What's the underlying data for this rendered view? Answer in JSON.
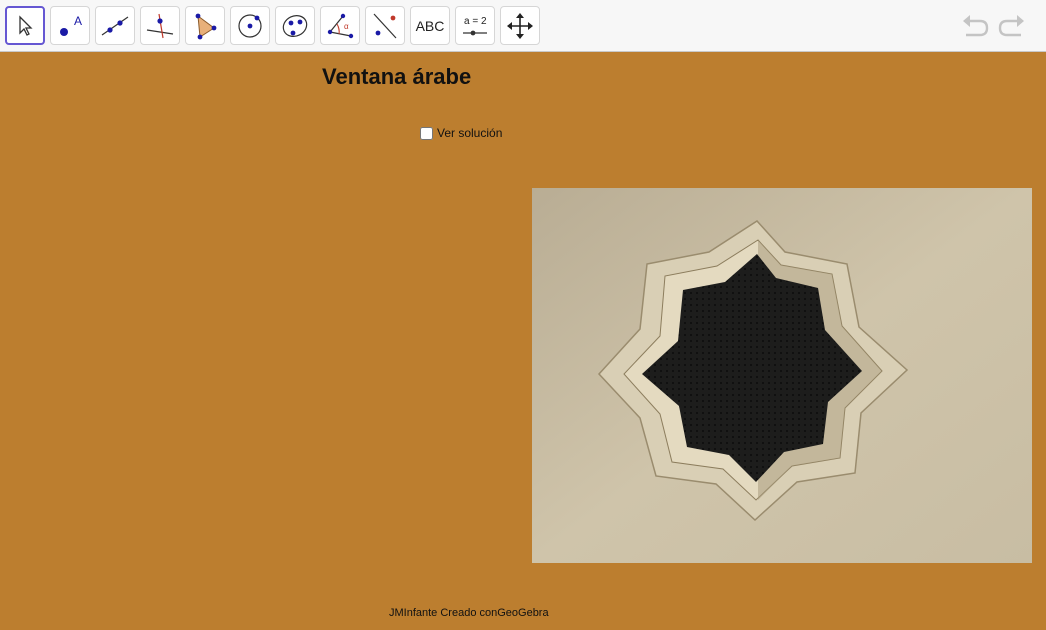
{
  "toolbar": {
    "tools": [
      {
        "id": "move",
        "icon": "pointer-arrow-icon",
        "selected": true
      },
      {
        "id": "point",
        "icon": "point-icon",
        "label": "A"
      },
      {
        "id": "line",
        "icon": "line-through-points-icon"
      },
      {
        "id": "perpendicular",
        "icon": "perpendicular-line-icon"
      },
      {
        "id": "polygon",
        "icon": "polygon-icon"
      },
      {
        "id": "circle",
        "icon": "circle-center-point-icon"
      },
      {
        "id": "conic",
        "icon": "ellipse-icon"
      },
      {
        "id": "angle",
        "icon": "angle-icon"
      },
      {
        "id": "reflect",
        "icon": "reflect-about-line-icon"
      },
      {
        "id": "text",
        "icon": "text-icon",
        "label": "ABC"
      },
      {
        "id": "slider",
        "icon": "slider-icon",
        "label": "a = 2"
      },
      {
        "id": "move-graphics",
        "icon": "move-graphics-view-icon"
      }
    ],
    "undo_icon": "undo-icon",
    "redo_icon": "redo-icon"
  },
  "canvas": {
    "background": "#bc7e2f",
    "title": "Ventana árabe",
    "checkbox_label": "Ver solución",
    "checkbox_checked": false,
    "footer": "JMInfante Creado conGeoGebra"
  },
  "colors": {
    "toolbar_bg": "#f7f7f7",
    "selected_border": "#6557d2",
    "point_blue": "#1a1aa6"
  }
}
